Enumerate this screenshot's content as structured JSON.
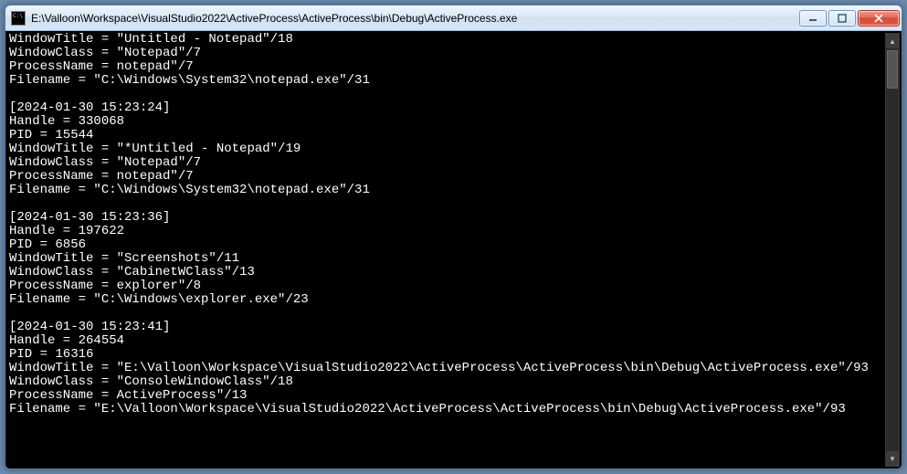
{
  "window": {
    "title": "E:\\Valloon\\Workspace\\VisualStudio2022\\ActiveProcess\\ActiveProcess\\bin\\Debug\\ActiveProcess.exe"
  },
  "console": {
    "lines": [
      "WindowTitle = \"Untitled - Notepad\"/18",
      "WindowClass = \"Notepad\"/7",
      "ProcessName = notepad\"/7",
      "Filename = \"C:\\Windows\\System32\\notepad.exe\"/31",
      "",
      "[2024-01-30 15:23:24]",
      "Handle = 330068",
      "PID = 15544",
      "WindowTitle = \"*Untitled - Notepad\"/19",
      "WindowClass = \"Notepad\"/7",
      "ProcessName = notepad\"/7",
      "Filename = \"C:\\Windows\\System32\\notepad.exe\"/31",
      "",
      "[2024-01-30 15:23:36]",
      "Handle = 197622",
      "PID = 6856",
      "WindowTitle = \"Screenshots\"/11",
      "WindowClass = \"CabinetWClass\"/13",
      "ProcessName = explorer\"/8",
      "Filename = \"C:\\Windows\\explorer.exe\"/23",
      "",
      "[2024-01-30 15:23:41]",
      "Handle = 264554",
      "PID = 16316",
      "WindowTitle = \"E:\\Valloon\\Workspace\\VisualStudio2022\\ActiveProcess\\ActiveProcess\\bin\\Debug\\ActiveProcess.exe\"/93",
      "WindowClass = \"ConsoleWindowClass\"/18",
      "ProcessName = ActiveProcess\"/13",
      "Filename = \"E:\\Valloon\\Workspace\\VisualStudio2022\\ActiveProcess\\ActiveProcess\\bin\\Debug\\ActiveProcess.exe\"/93",
      ""
    ]
  }
}
